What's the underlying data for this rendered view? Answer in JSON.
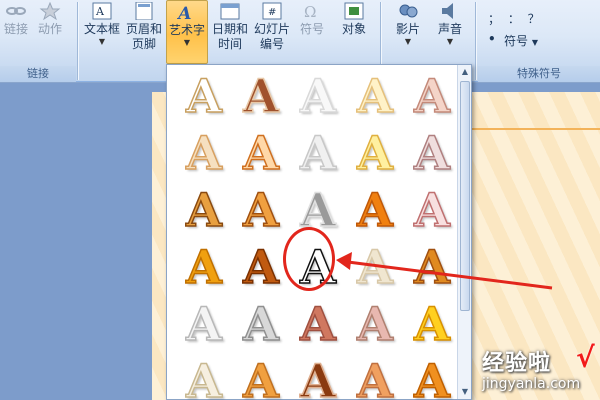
{
  "ribbon": {
    "groups": {
      "links": "链接",
      "special_symbols": "特殊符号"
    },
    "buttons": {
      "hyperlink": "链接",
      "action": "动作",
      "textbox": "文本框",
      "header_footer_1": "页眉和",
      "header_footer_2": "页脚",
      "wordart": "艺术字",
      "datetime_1": "日期和",
      "datetime_2": "时间",
      "slide_number_1": "幻灯片",
      "slide_number_2": "编号",
      "symbol": "符号",
      "object": "对象",
      "movie": "影片",
      "sound": "声音",
      "symbol_small": "符号",
      "punct_row": "；  ：  ？",
      "bullet": "•"
    },
    "datetime_icon_text": "#"
  },
  "gallery": {
    "glyph": "A",
    "selected_index": 12,
    "styles": [
      {
        "fill": "#ffffff",
        "stroke": "#c8a060"
      },
      {
        "fill": "#a0522d",
        "stroke": "#e8c9a8"
      },
      {
        "fill": "#f8f8f8",
        "stroke": "#d9d9d9"
      },
      {
        "fill": "#fff2c8",
        "stroke": "#e5c07b"
      },
      {
        "fill": "#f4d4c8",
        "stroke": "#c48a7a"
      },
      {
        "fill": "#f6e0c0",
        "stroke": "#d8a060"
      },
      {
        "fill": "#ffd8a8",
        "stroke": "#d07020"
      },
      {
        "fill": "#f0f0f0",
        "stroke": "#c8c8c8"
      },
      {
        "fill": "#fff0a0",
        "stroke": "#e0b040"
      },
      {
        "fill": "#f0dede",
        "stroke": "#b08080"
      },
      {
        "fill": "#e8a040",
        "stroke": "#8a4a10"
      },
      {
        "fill": "#f0a040",
        "stroke": "#a05010"
      },
      {
        "fill": "#9a9a9a",
        "stroke": "#e0e0e0"
      },
      {
        "fill": "#f08010",
        "stroke": "#c05808"
      },
      {
        "fill": "#f8e0e0",
        "stroke": "#c07070"
      },
      {
        "fill": "#f0a010",
        "stroke": "#c07000"
      },
      {
        "fill": "#c05a10",
        "stroke": "#7a3000"
      },
      {
        "fill": "#ffffff",
        "stroke": "#111111"
      },
      {
        "fill": "#f0e6d0",
        "stroke": "#d8c8a8"
      },
      {
        "fill": "#e08a20",
        "stroke": "#a05010"
      },
      {
        "fill": "#f4f4f4",
        "stroke": "#b8b8b8"
      },
      {
        "fill": "#d8d8d8",
        "stroke": "#909090"
      },
      {
        "fill": "#d07860",
        "stroke": "#a05040"
      },
      {
        "fill": "#e8b8b0",
        "stroke": "#b08070"
      },
      {
        "fill": "#ffd020",
        "stroke": "#d89000"
      },
      {
        "fill": "#f6efe0",
        "stroke": "#c8b890"
      },
      {
        "fill": "#f0a040",
        "stroke": "#c07020"
      },
      {
        "fill": "#8a3a10",
        "stroke": "#e0b090"
      },
      {
        "fill": "#f0a060",
        "stroke": "#c07040"
      },
      {
        "fill": "#f09020",
        "stroke": "#c06000"
      }
    ]
  },
  "watermark": {
    "title": "经验啦",
    "check": "√",
    "url": "jingyanla.com"
  },
  "colors": {
    "highlight": "#e2261c",
    "ribbon_active": "#ffc14a",
    "page": "#fdf0d6"
  }
}
